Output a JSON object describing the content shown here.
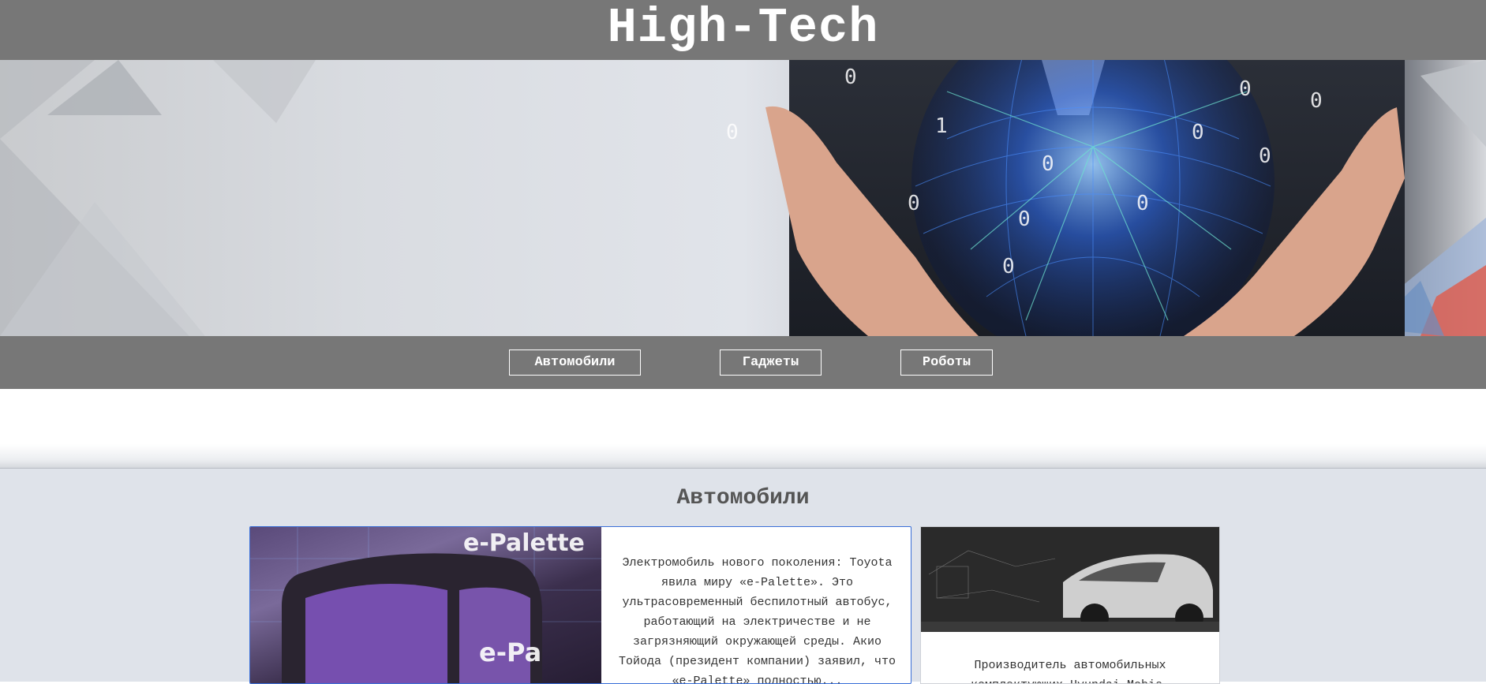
{
  "header": {
    "title": "High-Tech"
  },
  "nav": {
    "items": [
      {
        "label": "Автомобили"
      },
      {
        "label": "Гаджеты"
      },
      {
        "label": "Роботы"
      }
    ]
  },
  "section": {
    "title": "Автомобили",
    "cards": [
      {
        "text": "Электромобиль нового поколения: Toyota явила миру «e-Palette». Это ультрасовременный беспилотный автобус, работающий на электричестве и не загрязняющий окружающей среды. Акио Тойода (президент компании) заявил, что «e-Palette» полностью...",
        "image_label": "e-Palette"
      },
      {
        "text": "Производитель автомобильных комплектующих Hyundai Mobis,"
      }
    ]
  },
  "colors": {
    "header_bg": "#777777",
    "content_bg": "#dfe3ea",
    "card_border_active": "#3a6fd8"
  }
}
